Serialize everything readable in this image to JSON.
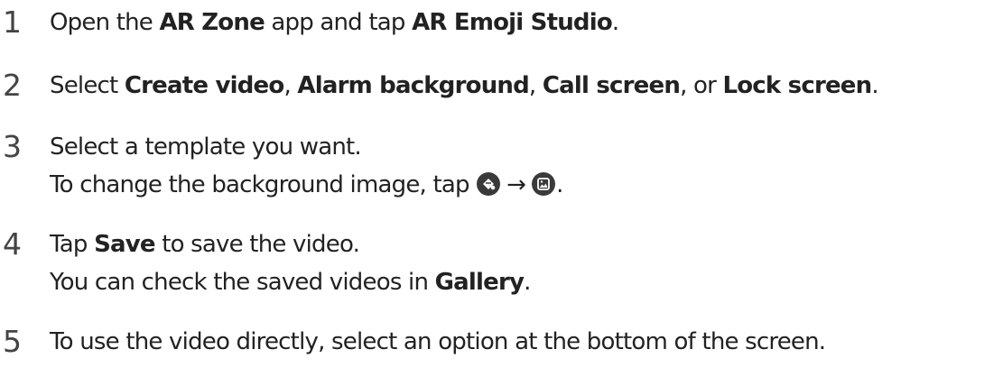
{
  "steps": [
    {
      "number": "1",
      "t1": "Open the ",
      "b1": "AR Zone",
      "t2": " app and tap ",
      "b2": "AR Emoji Studio",
      "t3": "."
    },
    {
      "number": "2",
      "t1": "Select ",
      "b1": "Create video",
      "t2": ", ",
      "b2": "Alarm background",
      "t3": ", ",
      "b3": "Call screen",
      "t4": ", or ",
      "b4": "Lock screen",
      "t5": "."
    },
    {
      "number": "3",
      "line1": "Select a template you want.",
      "line2_text": "To change the background image, tap ",
      "arrow": "→",
      "end": ".",
      "icons": [
        "background-edit-icon",
        "gallery-image-icon"
      ]
    },
    {
      "number": "4",
      "t1": "Tap ",
      "b1": "Save",
      "t2": " to save the video.",
      "line2_text": "You can check the saved videos in ",
      "line2_bold": "Gallery",
      "line2_end": "."
    },
    {
      "number": "5",
      "text": "To use the video directly, select an option at the bottom of the screen."
    }
  ],
  "colors": {
    "text": "#222222",
    "number": "#444444",
    "icon_bg": "#3a3a3a"
  }
}
